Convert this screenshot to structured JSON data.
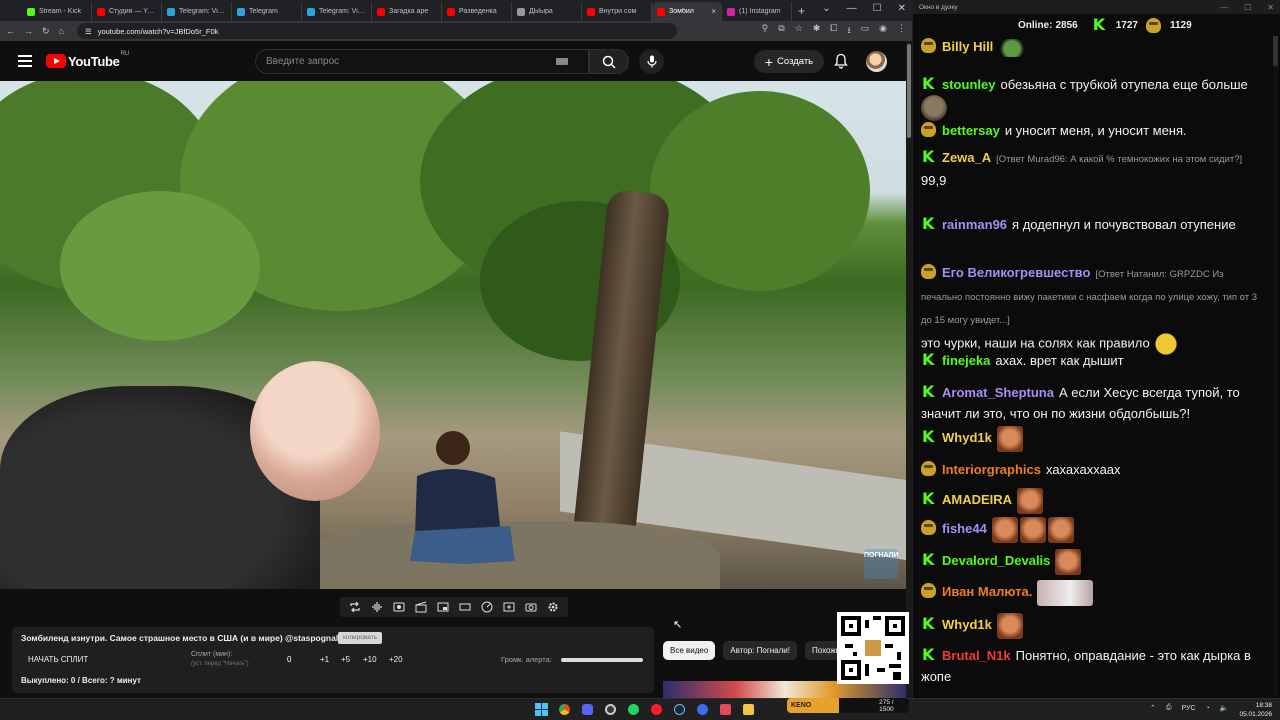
{
  "browser": {
    "tabs": [
      {
        "label": "Stream - Kick",
        "color": "#53fc18",
        "active": false
      },
      {
        "label": "Студия — YouTube",
        "color": "#ff0000",
        "active": false
      },
      {
        "label": "Telegram: View",
        "color": "#2aa3df",
        "active": false
      },
      {
        "label": "Telegram",
        "color": "#2aa3df",
        "active": false
      },
      {
        "label": "Telegram: View",
        "color": "#2aa3df",
        "active": false
      },
      {
        "label": "Загадка аре",
        "color": "#ff0000",
        "active": false
      },
      {
        "label": "Разведенка",
        "color": "#ff0000",
        "active": false
      },
      {
        "label": "ДЫыра",
        "color": "#999999",
        "active": false
      },
      {
        "label": "Внутри сом",
        "color": "#ff0000",
        "active": false
      },
      {
        "label": "Зомбил",
        "color": "#ff0000",
        "active": true
      },
      {
        "label": "(1) Instagram",
        "color": "#d6249f",
        "active": false
      }
    ],
    "url": "youtube.com/watch?v=JBfDo5r_F0k"
  },
  "youtube": {
    "logo_text": "YouTube",
    "region": "RU",
    "search_placeholder": "Введите запрос",
    "create_label": "Создать"
  },
  "video": {
    "watermark": "ПОГНАЛИ"
  },
  "split_panel": {
    "title": "Зомбиленд изнутри. Самое страшное место в США (и в мире) @staspognali",
    "copy_label": "копировать",
    "start_label": "НАЧАТЬ СПЛИТ",
    "split_min_label": "Сплит (мин):",
    "split_hint": "(уст. перед \"Начать\")",
    "split_value": "0",
    "increments": [
      "+1",
      "+5",
      "+10",
      "+20"
    ],
    "alert_label": "Громк. алерта:",
    "alert_volume": 1.0,
    "bought_label": "Выкуплено: 0 / Всего: ? минут"
  },
  "chips": [
    "Все видео",
    "Автор: Погнали!",
    "Похожие"
  ],
  "chat": {
    "window_title": "Окно в дуэку",
    "online_label": "Online:",
    "online_count": "2856",
    "kick_count": "1727",
    "twitch_count": "1129",
    "messages": [
      {
        "badge": "tw",
        "user": "Billy Hill",
        "color": "#f0d04a",
        "reply": "",
        "text": "",
        "emotes": [
          "e-frog"
        ]
      },
      {
        "badge": "k",
        "user": "stounley",
        "color": "#53fc18",
        "reply": "",
        "text": "обезьяна с трубкой отупела еще больше",
        "emotes": [
          "e-ape"
        ]
      },
      {
        "badge": "tw",
        "user": "bettersay",
        "color": "#53fc18",
        "reply": "",
        "text": "и уносит меня, и уносит меня.",
        "emotes": []
      },
      {
        "badge": "k",
        "user": "Zewa_A",
        "color": "#f0d04a",
        "reply": "[Ответ Murad96: А какой % темнокожих на этом сидит?]",
        "text": "99,9",
        "emotes": []
      },
      {
        "badge": "k",
        "user": "rainman96",
        "color": "#a98cf5",
        "reply": "",
        "text": "я додепнул и почувствовал отупение",
        "emotes": []
      },
      {
        "badge": "tw",
        "user": "Его Великогревшество",
        "color": "#a98cf5",
        "reply": "[Ответ Натанил: GRPZDC Из печально постоянно вижу пакетики с насфаем когда по улице хожу, тип от 3 до 15 могу увидет...]",
        "text": "это чурки, наши на солях как правило",
        "emotes": [
          "e-cool"
        ]
      },
      {
        "badge": "k",
        "user": "finejeka",
        "color": "#53fc18",
        "reply": "",
        "text": "ахах. врет как дышит",
        "emotes": []
      },
      {
        "badge": "k",
        "user": "Aromat_Sheptuna",
        "color": "#a98cf5",
        "reply": "",
        "text": "А если Хесус всегда тупой, то значит ли это, что он по жизни обдолбышь?!",
        "emotes": []
      },
      {
        "badge": "k",
        "user": "Whyd1k",
        "color": "#f0d04a",
        "reply": "",
        "text": "",
        "emotes": [
          "e-face"
        ]
      },
      {
        "badge": "tw",
        "user": "Interiorgraphics",
        "color": "#f07b2a",
        "reply": "",
        "text": "хахахаххаах",
        "emotes": []
      },
      {
        "badge": "k",
        "user": "AMADEIRA",
        "color": "#f0d04a",
        "reply": "",
        "text": "",
        "emotes": [
          "e-face"
        ]
      },
      {
        "badge": "tw",
        "user": "fishe44",
        "color": "#a98cf5",
        "reply": "",
        "text": "",
        "emotes": [
          "e-face",
          "e-face",
          "e-face"
        ]
      },
      {
        "badge": "k",
        "user": "Devalord_Devalis",
        "color": "#53fc18",
        "reply": "",
        "text": "",
        "emotes": [
          "e-face"
        ]
      },
      {
        "badge": "tw",
        "user": "Иван Малюта.",
        "color": "#f07b2a",
        "reply": "",
        "text": "",
        "emotes": [
          "e-pale"
        ]
      },
      {
        "badge": "k",
        "user": "Whyd1k",
        "color": "#f0d04a",
        "reply": "",
        "text": "",
        "emotes": [
          "e-face"
        ]
      },
      {
        "badge": "k",
        "user": "Brutal_N1k",
        "color": "#f03a3a",
        "reply": "",
        "text": "Понятно, оправдание - это как дырка в жопе",
        "emotes": []
      }
    ]
  },
  "taskbar": {
    "kick_widget_label": "KENO PARTY",
    "kick_widget_progress": "275 / 1500",
    "lang": "РУС",
    "time": "18:38",
    "date": "05.01.2026"
  },
  "colors": {
    "kick_green": "#53fc18",
    "youtube_red": "#ff0000",
    "bg": "#0f0f0f"
  }
}
